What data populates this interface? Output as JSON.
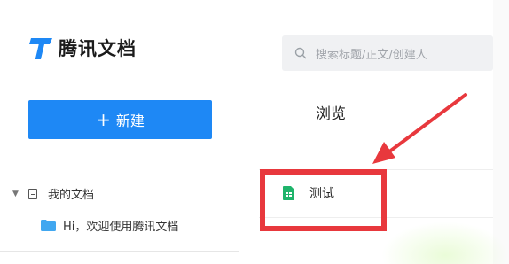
{
  "app": {
    "name": "腾讯文档"
  },
  "sidebar": {
    "new_button_label": "新建",
    "tree": [
      {
        "label": "我的文档"
      },
      {
        "label": "Hi，欢迎使用腾讯文档"
      }
    ]
  },
  "search": {
    "placeholder": "搜索标题/正文/创建人"
  },
  "main": {
    "section_title": "浏览",
    "files": [
      {
        "name": "测试",
        "type": "sheet"
      }
    ]
  },
  "colors": {
    "accent": "#1e88f5",
    "sheet_icon": "#1fb46b",
    "annotation": "#e8383d",
    "folder": "#41a7f0"
  },
  "icons": {
    "logo": "tencent-docs-logo",
    "search": "search-icon",
    "doc": "document-icon",
    "folder": "folder-icon",
    "sheet": "spreadsheet-icon"
  }
}
